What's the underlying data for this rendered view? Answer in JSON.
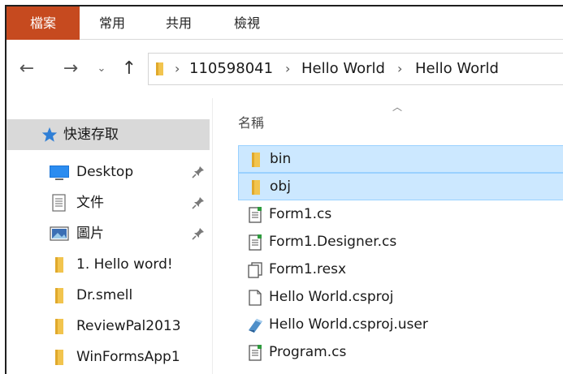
{
  "ribbon": {
    "tabs": [
      {
        "label": "檔案"
      },
      {
        "label": "常用"
      },
      {
        "label": "共用"
      },
      {
        "label": "檢視"
      }
    ]
  },
  "address": {
    "crumbs": [
      "110598041",
      "Hello World",
      "Hello World"
    ]
  },
  "sidebar": {
    "quick_access": {
      "label": "快速存取",
      "icon": "star-icon"
    },
    "items": [
      {
        "label": "Desktop",
        "icon": "desktop-icon",
        "pinned": true
      },
      {
        "label": "文件",
        "icon": "document-icon",
        "pinned": true
      },
      {
        "label": "圖片",
        "icon": "picture-icon",
        "pinned": true
      },
      {
        "label": "1. Hello word!",
        "icon": "folder-icon",
        "pinned": false
      },
      {
        "label": "Dr.smell",
        "icon": "folder-icon",
        "pinned": false
      },
      {
        "label": "ReviewPal2013",
        "icon": "folder-icon",
        "pinned": false
      },
      {
        "label": "WinFormsApp1",
        "icon": "folder-icon",
        "pinned": false
      }
    ]
  },
  "content": {
    "column_header": "名稱",
    "files": [
      {
        "name": "bin",
        "icon": "folder-icon",
        "selected": true
      },
      {
        "name": "obj",
        "icon": "folder-icon",
        "selected": true
      },
      {
        "name": "Form1.cs",
        "icon": "cs-file-icon",
        "selected": false
      },
      {
        "name": "Form1.Designer.cs",
        "icon": "cs-file-icon",
        "selected": false
      },
      {
        "name": "Form1.resx",
        "icon": "resx-file-icon",
        "selected": false
      },
      {
        "name": "Hello World.csproj",
        "icon": "blank-file-icon",
        "selected": false
      },
      {
        "name": "Hello World.csproj.user",
        "icon": "user-file-icon",
        "selected": false
      },
      {
        "name": "Program.cs",
        "icon": "cs-file-icon",
        "selected": false
      }
    ]
  },
  "colors": {
    "file_tab": "#c64a1f",
    "selection": "#cce8ff",
    "selection_border": "#99d1ff",
    "quick_access_bg": "#d9d9d9",
    "folder": "#f2c44e"
  }
}
